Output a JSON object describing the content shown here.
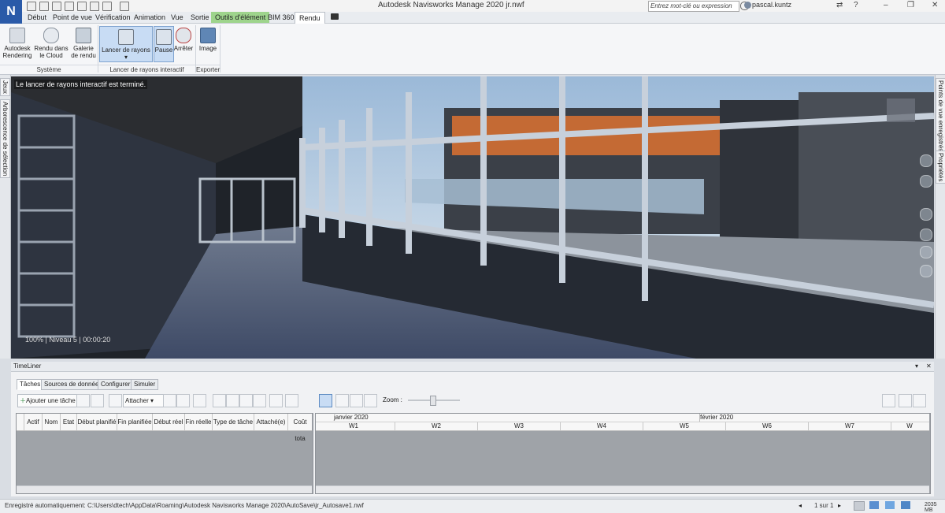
{
  "app": {
    "logo_letter": "N",
    "window_title": "Autodesk Navisworks Manage 2020   jr.nwf",
    "search_placeholder": "Entrez mot-clé ou expression",
    "username": "pascal.kuntz"
  },
  "menu_tabs": [
    "Début",
    "Point de vue",
    "Vérification",
    "Animation",
    "Vue",
    "Sortie",
    "Outils d'élément",
    "BIM 360",
    "Rendu"
  ],
  "ribbon": {
    "buttons": [
      {
        "label": "Autodesk Rendering",
        "icon": "render-teapot-icon"
      },
      {
        "label": "Rendu dans le Cloud",
        "icon": "cloud-render-icon"
      },
      {
        "label": "Galerie de rendu",
        "icon": "gallery-icon"
      },
      {
        "label": "Lancer de rayons",
        "icon": "ray-trace-icon"
      },
      {
        "label": "Pause",
        "icon": "pause-icon"
      },
      {
        "label": "Arrêter",
        "icon": "stop-icon"
      },
      {
        "label": "Image",
        "icon": "image-export-icon"
      }
    ],
    "panels": [
      "Système",
      "Lancer de rayons interactif",
      "Exporter"
    ]
  },
  "side_tabs": {
    "left": [
      "Jeux",
      "Arborescence de sélection"
    ],
    "right": [
      "Points de vue enregistrés",
      "Propriétés"
    ]
  },
  "viewport": {
    "notice": "Le lancer de rayons interactif est terminé.",
    "status": "100%  |  Niveau 5  |  00:00:20"
  },
  "timeliner": {
    "title": "TimeLiner",
    "tabs": [
      "Tâches",
      "Sources de données",
      "Configurer",
      "Simuler"
    ],
    "add_task": "Ajouter une tâche",
    "attach": "Attacher",
    "zoom_label": "Zoom :",
    "columns": [
      "Actif",
      "Nom",
      "Etat",
      "Début planifié",
      "Fin planifiée",
      "Début réel",
      "Fin réelle",
      "Type de tâche",
      "Attaché(e)",
      "Coût tota"
    ],
    "months": [
      "janvier 2020",
      "février 2020"
    ],
    "weeks": [
      "W1",
      "W2",
      "W3",
      "W4",
      "W5",
      "W6",
      "W7",
      "W"
    ]
  },
  "statusbar": {
    "autosave": "Enregistré automatiquement: C:\\Users\\dtech\\AppData\\Roaming\\Autodesk Navisworks Manage 2020\\AutoSave\\jr_Autosave1.nwf",
    "page": "1 sur 1",
    "memory": "2035 MB"
  },
  "colors": {
    "accent_blue": "#2a5aa8",
    "active_tab_green": "#9ed48c",
    "selected_button": "#c8dcf4"
  }
}
